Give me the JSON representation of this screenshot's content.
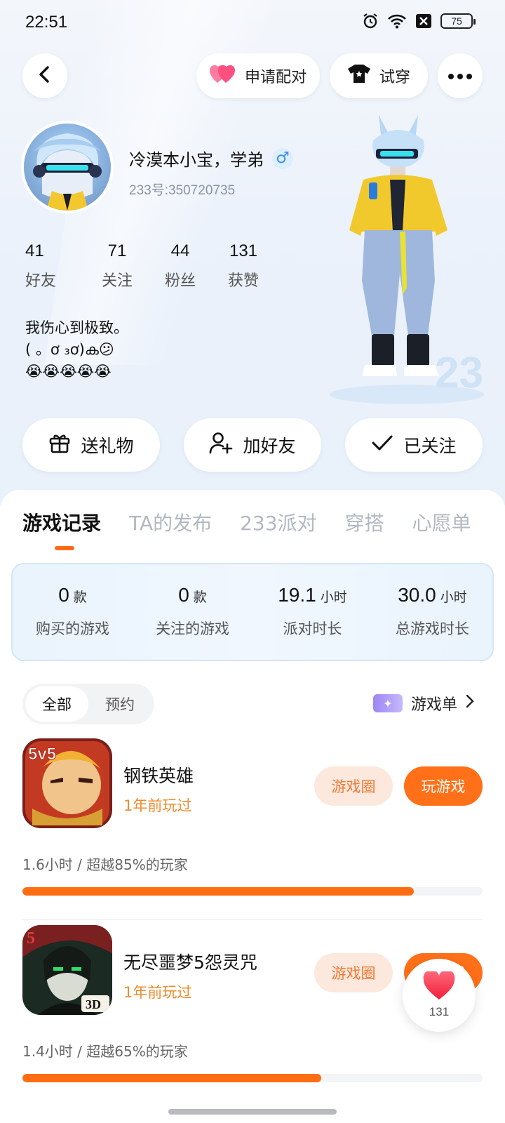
{
  "status_bar": {
    "time": "22:51",
    "battery": "75",
    "icons": [
      "alarm-icon",
      "wifi-icon",
      "x-box-icon",
      "battery-icon"
    ]
  },
  "header": {
    "back_icon": "chevron-left-icon",
    "match_label": "申请配对",
    "try_on_label": "试穿",
    "more_icon": "more-icon"
  },
  "profile": {
    "name": "冷漠本小宝，学弟",
    "gender_symbol": "♂",
    "uid": "233号:350720735",
    "stats": [
      {
        "value": "41",
        "label": "好友"
      },
      {
        "value": "71",
        "label": "关注"
      },
      {
        "value": "44",
        "label": "粉丝"
      },
      {
        "value": "131",
        "label": "获赞"
      }
    ],
    "bio": "我伤心到极致。\n( 。ơ ₃ơ)ക😕\n😭😭😭😭😭"
  },
  "actions": {
    "gift_label": "送礼物",
    "add_friend_label": "加好友",
    "followed_label": "已关注"
  },
  "tabs": [
    {
      "label": "游戏记录",
      "active": true
    },
    {
      "label": "TA的发布",
      "active": false
    },
    {
      "label": "233派对",
      "active": false
    },
    {
      "label": "穿搭",
      "active": false
    },
    {
      "label": "心愿单",
      "active": false
    }
  ],
  "summary": [
    {
      "value": "0",
      "unit": "款",
      "label": "购买的游戏"
    },
    {
      "value": "0",
      "unit": "款",
      "label": "关注的游戏"
    },
    {
      "value": "19.1",
      "unit": "小时",
      "label": "派对时长"
    },
    {
      "value": "30.0",
      "unit": "小时",
      "label": "总游戏时长"
    }
  ],
  "filter": {
    "all_label": "全部",
    "reserve_label": "预约",
    "game_list_label": "游戏单"
  },
  "games": [
    {
      "name": "钢铁英雄",
      "last_played": "1年前玩过",
      "circle_label": "游戏圈",
      "play_label": "玩游戏",
      "stat": "1.6小时 / 超越85%的玩家",
      "progress": 0.85
    },
    {
      "name": "无尽噩梦5怨灵咒",
      "last_played": "1年前玩过",
      "circle_label": "游戏圈",
      "play_label": "玩游戏",
      "stat": "1.4小时 / 超越65%的玩家",
      "progress": 0.65
    }
  ],
  "like_fab": {
    "count": "131"
  },
  "colors": {
    "accent": "#ff6d12",
    "accent_soft": "#fde8dd",
    "link_orange": "#f08a2a",
    "male_blue": "#3d8ef0"
  }
}
